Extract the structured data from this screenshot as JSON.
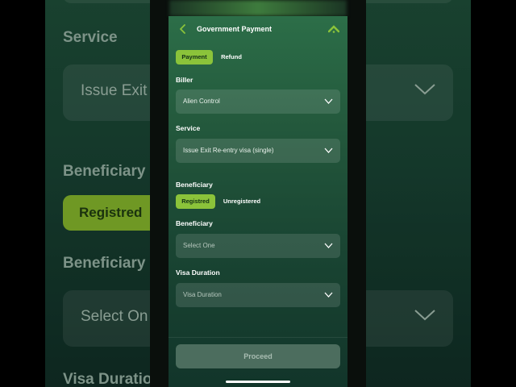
{
  "background": {
    "service_label": "Service",
    "service_value": "Issue Exit",
    "beneficiary_label": "Beneficiary",
    "registered_label": "Registred",
    "beneficiary_select_label": "Beneficiary",
    "beneficiary_select_value": "Select On",
    "visa_duration_label": "Visa Duratio"
  },
  "header": {
    "title": "Government Payment"
  },
  "tabs": {
    "payment": "Payment",
    "refund": "Refund",
    "active": "payment"
  },
  "biller": {
    "label": "Biller",
    "value": "Alien Control"
  },
  "service": {
    "label": "Service",
    "value": "Issue Exit Re-entry visa (single)"
  },
  "beneficiary_section": {
    "label": "Beneficiary",
    "registered": "Registred",
    "unregistered": "Unregistered",
    "active": "registered"
  },
  "beneficiary": {
    "label": "Beneficiary",
    "placeholder": "Select One"
  },
  "visa_duration": {
    "label": "Visa Duration",
    "placeholder": "Visa Duration"
  },
  "proceed_label": "Proceed",
  "colors": {
    "accent": "#8bc33a",
    "screen_top": "#2c6e48",
    "screen_bottom": "#12352a",
    "button_disabled": "#4c6d5e"
  },
  "icons": [
    "chevron-left-icon",
    "brand-logo-icon",
    "chevron-down-icon"
  ]
}
